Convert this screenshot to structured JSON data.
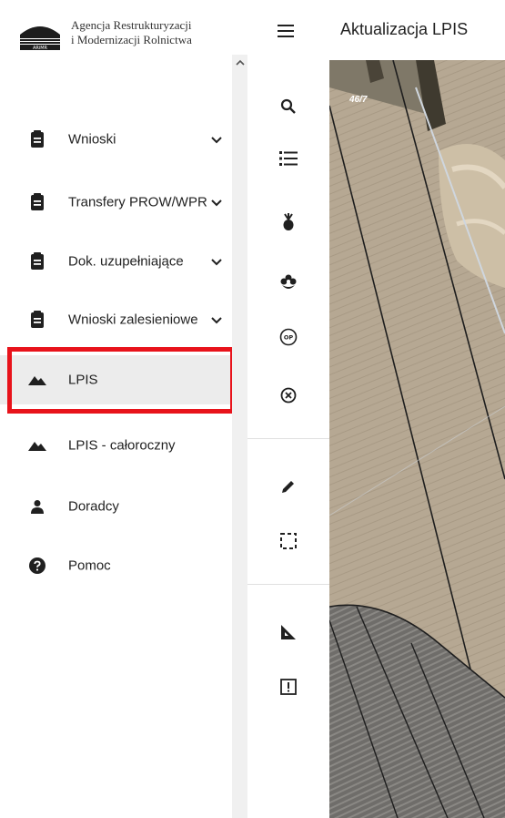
{
  "logo": {
    "line1": "Agencja Restrukturyzacji",
    "line2": "i Modernizacji Rolnictwa",
    "mark_text": "ARiMR"
  },
  "nav": {
    "items": [
      {
        "label": "Wnioski",
        "icon": "clipboard-icon",
        "has_chevron": true
      },
      {
        "label": "Transfery PROW/WPR",
        "icon": "clipboard-icon",
        "has_chevron": true
      },
      {
        "label": "Dok. uzupełniające",
        "icon": "clipboard-icon",
        "has_chevron": true
      },
      {
        "label": "Wnioski zalesieniowe",
        "icon": "clipboard-icon",
        "has_chevron": true
      },
      {
        "label": "LPIS",
        "icon": "terrain-icon",
        "has_chevron": false,
        "active": true
      },
      {
        "label": "LPIS - całoroczny",
        "icon": "terrain-icon",
        "has_chevron": false
      },
      {
        "label": "Doradcy",
        "icon": "person-icon",
        "has_chevron": false
      },
      {
        "label": "Pomoc",
        "icon": "help-icon",
        "has_chevron": false
      }
    ]
  },
  "header": {
    "title": "Aktualizacja LPIS",
    "menu_icon": "hamburger-icon"
  },
  "tools": [
    {
      "name": "search-icon"
    },
    {
      "name": "list-icon"
    },
    {
      "name": "crop-icon"
    },
    {
      "name": "flower-icon"
    },
    {
      "name": "op-badge-icon",
      "text": "OP"
    },
    {
      "name": "close-circle-icon"
    },
    {
      "name": "pencil-icon"
    },
    {
      "name": "select-area-icon"
    },
    {
      "name": "measure-icon"
    },
    {
      "name": "report-icon"
    }
  ],
  "map": {
    "parcel_label": "46/7"
  },
  "colors": {
    "highlight": "#e8131b",
    "active_bg": "#ececec",
    "icon": "#202020"
  }
}
